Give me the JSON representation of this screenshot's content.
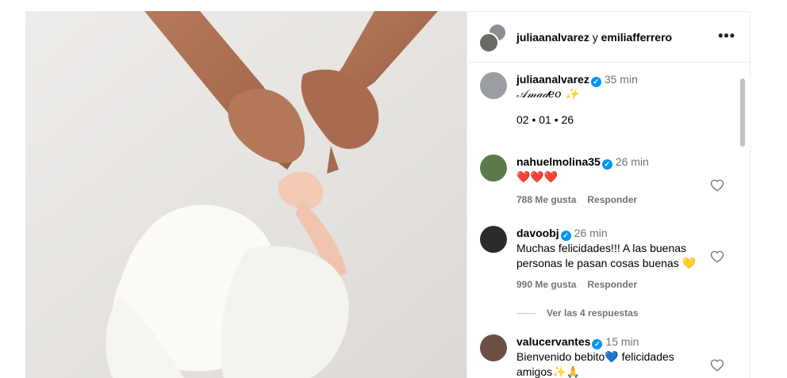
{
  "post": {
    "header_user1": "juliaanalvarez",
    "header_conj": " y ",
    "header_user2": "emiliafferrero",
    "more_label": "•••"
  },
  "caption": {
    "username": "juliaanalvarez",
    "time": "35 min",
    "text": "𝒜𝓂𝒶𝒹𝑒𝑜 ✨",
    "date": "02 • 01 • 26"
  },
  "comments": [
    {
      "username": "nahuelmolina35",
      "time": "26 min",
      "text": "❤️❤️❤️",
      "likes": "788 Me gusta",
      "reply": "Responder"
    },
    {
      "username": "davoobj",
      "time": "26 min",
      "text": "Muchas felicidades!!! A las buenas personas le pasan cosas buenas 💛",
      "likes": "990 Me gusta",
      "reply": "Responder",
      "view_replies": "Ver las 4 respuestas"
    },
    {
      "username": "valucervantes",
      "time": "15 min",
      "text": "Bienvenido bebito💙 felicidades amigos✨🙏"
    }
  ],
  "colors": {
    "verified": "#0095f6",
    "meta": "#737373",
    "divider": "#efefef"
  }
}
